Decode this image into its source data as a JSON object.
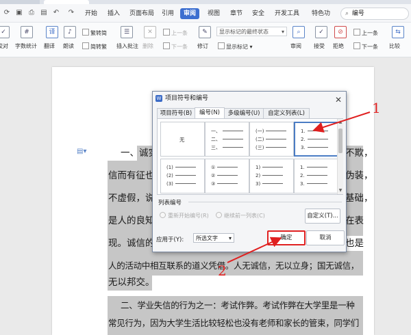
{
  "tabstrip": {
    "colors": {
      "accent": "#3d6fd0"
    }
  },
  "menubar": {
    "items": [
      "开始",
      "插入",
      "页面布局",
      "引用",
      "审阅",
      "视图",
      "章节",
      "安全",
      "开发工具",
      "特色功"
    ],
    "active": "审阅",
    "search_placeholder": "编号"
  },
  "ribbon": {
    "left_labels": [
      "校对",
      "字数统计",
      "翻译",
      "朗读"
    ],
    "convert_trad": "繁转简",
    "convert_simp": "简转繁",
    "insert_comment": "插入批注",
    "delete": "删除",
    "prev": "上一条",
    "next": "下一条",
    "revise": "修订",
    "markup_dropdown": "显示标记的最终状态",
    "show_markup": "显示标记",
    "review": "审阅",
    "accept": "接受",
    "reject": "拒绝",
    "prev2": "上一条",
    "next2": "下一条",
    "compare": "比较"
  },
  "document": {
    "lines": [
      "一、诚实",
      "不欺，",
      "信而有征也",
      "伪装，",
      "不虚假，说",
      "基础，",
      "是人的良知",
      "在表",
      "现。诚信的",
      "也是",
      "人的活动中相互联系的道义凭借。人无诚信，无以立身；国无诚信，",
      "无以邦交。",
      "二、学业失信的行为之一：考试作弊。考试作弊在大学里是一种",
      "常见行为，因为大学生活比较轻松也没有老师和家长的管束，同学们"
    ]
  },
  "dialog": {
    "title": "项目符号和编号",
    "tabs": [
      "项目符号(B)",
      "编号(N)",
      "多级编号(U)",
      "自定义列表(L)"
    ],
    "active_tab": "编号(N)",
    "cells": [
      {
        "label": "无",
        "rows": []
      },
      {
        "label": "",
        "rows": [
          "一、",
          "二、",
          "三、"
        ]
      },
      {
        "label": "",
        "rows": [
          "(一)",
          "(二)",
          "(三)"
        ]
      },
      {
        "label": "",
        "rows": [
          "1.",
          "2.",
          "3."
        ]
      },
      {
        "label": "",
        "rows": [
          "(1)",
          "(2)",
          "(3)"
        ]
      },
      {
        "label": "",
        "rows": [
          "①",
          "②",
          "③"
        ]
      },
      {
        "label": "",
        "rows": [
          "1)",
          "2)",
          "3)"
        ]
      },
      {
        "label": "",
        "rows": [
          "1.",
          "2.",
          "3."
        ]
      }
    ],
    "selected_cell": 3,
    "list_group_label": "列表编号",
    "restart_label": "重新开始编号(R)",
    "continue_label": "继续前一列表(C)",
    "customize_button": "自定义(T)...",
    "apply_label": "应用于(Y):",
    "apply_value": "所选文字",
    "ok_button": "确定",
    "cancel_button": "取消"
  },
  "annotations": {
    "one": "1",
    "two": "2"
  }
}
